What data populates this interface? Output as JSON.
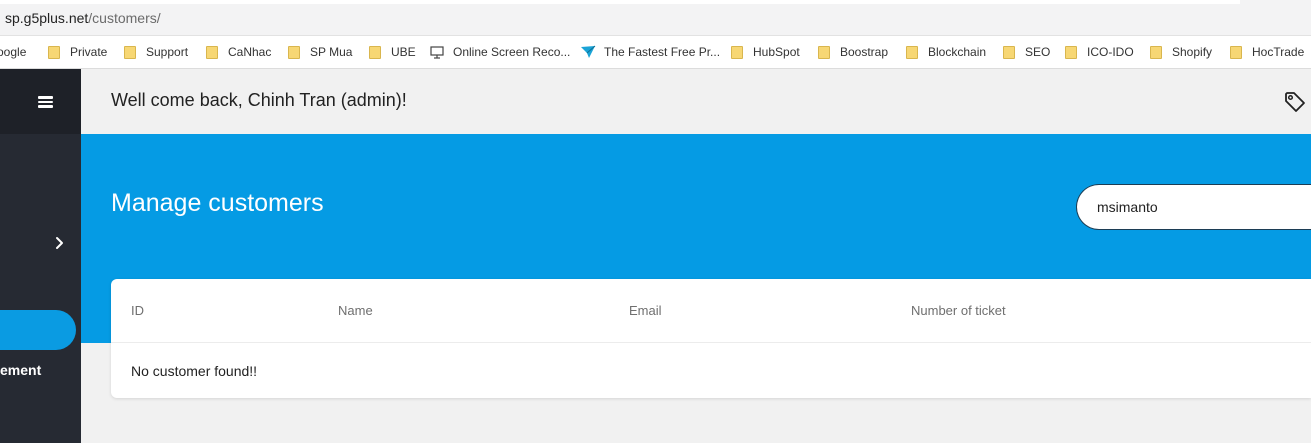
{
  "browser": {
    "url_host": "sp.g5plus.net",
    "url_path": "/customers/"
  },
  "bookmarks": [
    {
      "label": "oogle",
      "icon": "none"
    },
    {
      "label": "Private",
      "icon": "folder-icon"
    },
    {
      "label": "Support",
      "icon": "folder-icon"
    },
    {
      "label": "CaNhac",
      "icon": "folder-icon"
    },
    {
      "label": "SP Mua",
      "icon": "folder-icon"
    },
    {
      "label": "UBE",
      "icon": "folder-icon"
    },
    {
      "label": "Online Screen Reco...",
      "icon": "monitor-icon"
    },
    {
      "label": "The Fastest Free Pr...",
      "icon": "arrow-icon"
    },
    {
      "label": "HubSpot",
      "icon": "folder-icon"
    },
    {
      "label": "Boostrap",
      "icon": "folder-icon"
    },
    {
      "label": "Blockchain",
      "icon": "folder-icon"
    },
    {
      "label": "SEO",
      "icon": "folder-icon"
    },
    {
      "label": "ICO-IDO",
      "icon": "folder-icon"
    },
    {
      "label": "Shopify",
      "icon": "folder-icon"
    },
    {
      "label": "HocTrade",
      "icon": "folder-icon"
    }
  ],
  "sidebar": {
    "menu_icon": "hamburger-icon",
    "expand_icon": "chevron-right-icon",
    "item_label": "ement"
  },
  "header": {
    "welcome": "Well come back, Chinh Tran (admin)!",
    "right_icon": "tag-icon"
  },
  "page": {
    "title": "Manage customers",
    "search_value": "msimanto"
  },
  "table": {
    "columns": [
      "ID",
      "Name",
      "Email",
      "Number of ticket"
    ],
    "empty_message": "No customer found!!"
  },
  "colors": {
    "accent": "#059be4",
    "sidebar": "#262a33",
    "sidebar_top": "#1e2128",
    "active_item": "#0a9be2"
  }
}
